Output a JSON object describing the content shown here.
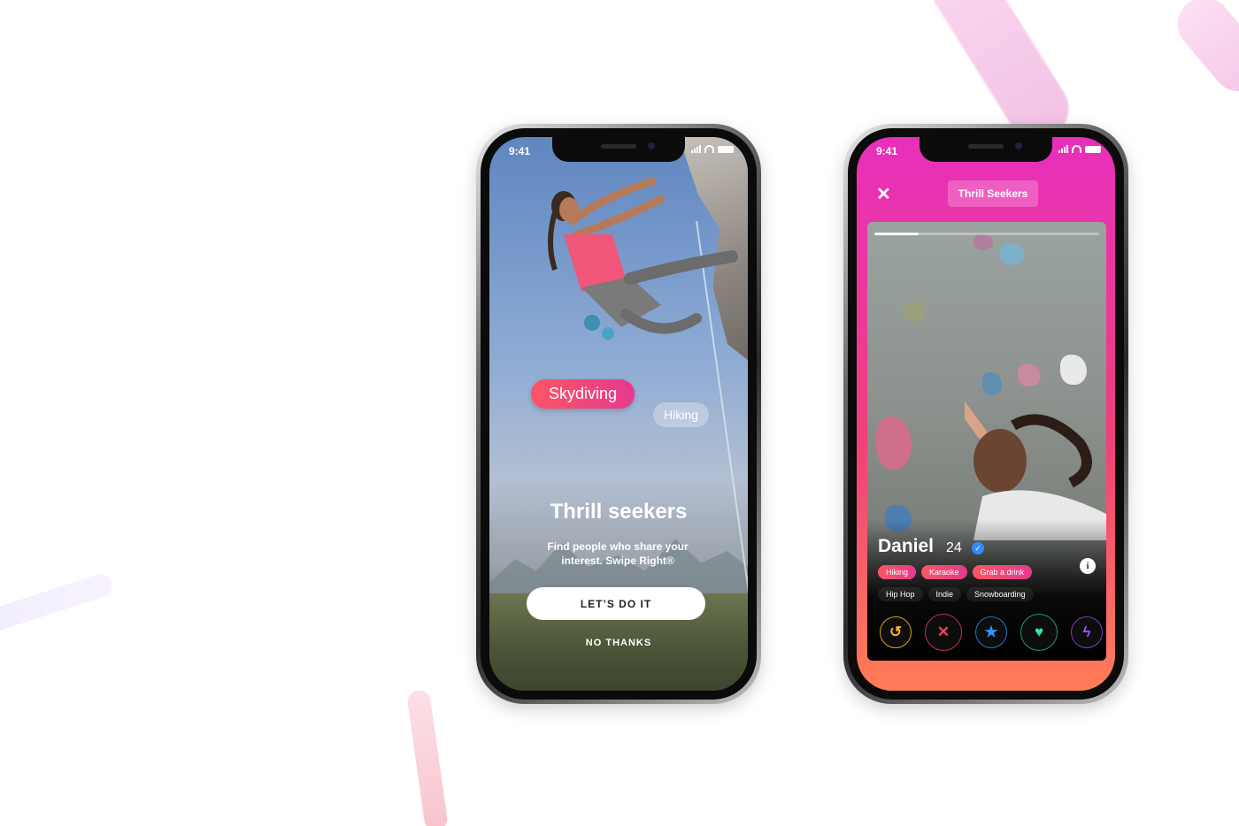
{
  "phone1": {
    "time": "9:41",
    "interests": [
      "Skydiving",
      "Hiking"
    ],
    "title": "Thrill seekers",
    "subtitle": "Find people who share your interest. Swipe Right®",
    "primary_button": "LET’S DO IT",
    "secondary_button": "NO THANKS"
  },
  "phone2": {
    "time": "9:41",
    "close_icon": "close-icon",
    "header_tag": "Thrill Seekers",
    "profile": {
      "name": "Daniel",
      "age": "24",
      "verified_icon": "verified-badge-icon",
      "info_icon": "info-icon",
      "highlight_tags": [
        "Hiking",
        "Karaoke",
        "Grab a drink"
      ],
      "tags": [
        "Hip Hop",
        "Indie",
        "Snowboarding"
      ]
    },
    "actions": [
      "rewind-icon",
      "nope-icon",
      "super-like-icon",
      "like-icon",
      "boost-icon"
    ]
  },
  "colors": {
    "brand_gradient_start": "#fd5564",
    "brand_gradient_end": "#e53a8f",
    "screen2_top": "#e72fbd",
    "screen2_bottom": "#ff7d57"
  }
}
